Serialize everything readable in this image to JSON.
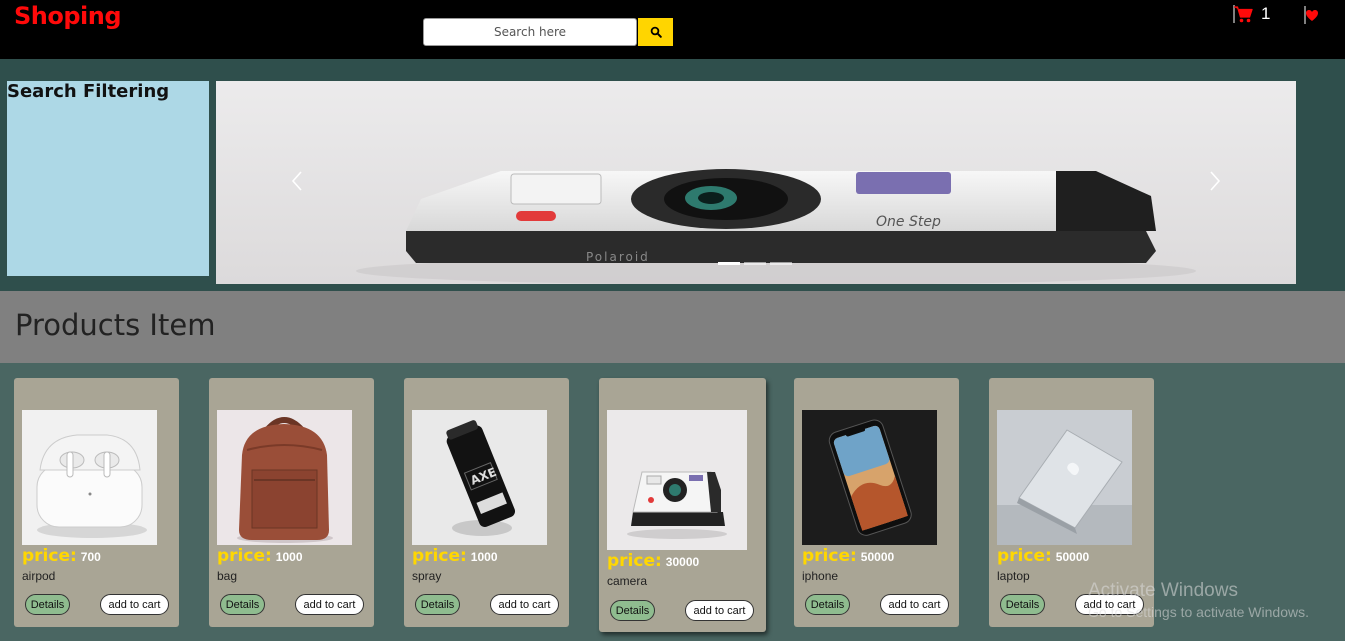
{
  "header": {
    "brand": "Shoping",
    "search_placeholder": "Search here",
    "cart_count": "1"
  },
  "sidebar": {
    "title": "Search Filtering"
  },
  "carousel": {
    "slide_caption": "Polaroid"
  },
  "products": {
    "title": "Products Item",
    "price_label": "price:",
    "details_label": "Details",
    "add_to_cart_label": "add to cart",
    "items": [
      {
        "name": "airpod",
        "price": "700"
      },
      {
        "name": "bag",
        "price": "1000"
      },
      {
        "name": "spray",
        "price": "1000"
      },
      {
        "name": "camera",
        "price": "30000"
      },
      {
        "name": "iphone",
        "price": "50000"
      },
      {
        "name": "laptop",
        "price": "50000"
      }
    ]
  },
  "watermark": {
    "line1": "Activate Windows",
    "line2": "Go to Settings to activate Windows."
  },
  "colors": {
    "brand": "#ff0a0a",
    "topbar": "#000000",
    "search_button": "#ffd500",
    "price_label": "#ffd700",
    "card_bg": "#a9a595",
    "details_button": "#8fbc8f",
    "filter_bg": "#add8e6"
  },
  "icons": [
    "search-icon",
    "cart-icon",
    "heart-icon",
    "chevron-left-icon",
    "chevron-right-icon"
  ]
}
